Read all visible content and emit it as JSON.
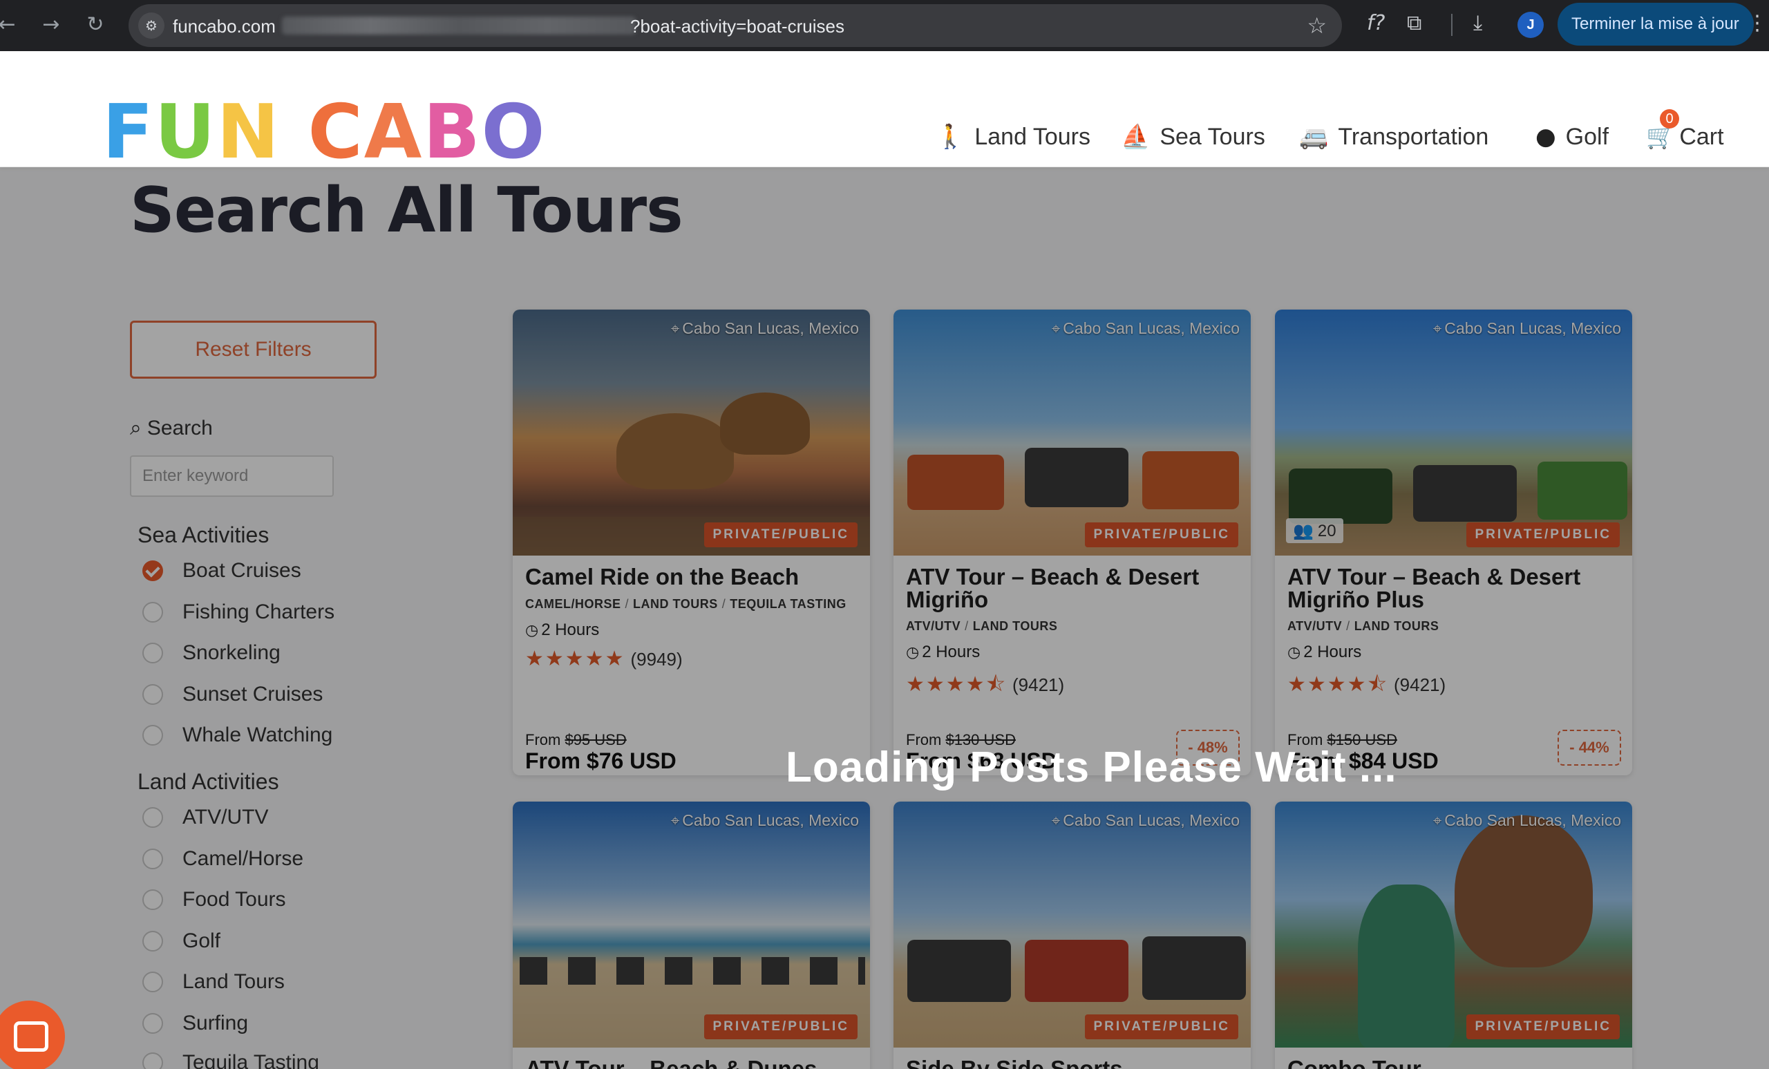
{
  "browser": {
    "url_host": "funcabo.com",
    "url_query": "?boat-activity=boat-cruises",
    "update_label": "Terminer la mise à jour",
    "profile_initial": "J",
    "icons": [
      "back-icon",
      "forward-icon",
      "reload-icon",
      "site-settings-icon",
      "bookmark-star-icon",
      "formula-icon",
      "extensions-icon",
      "download-icon",
      "menu-kebab-icon"
    ]
  },
  "site": {
    "logo_letters": [
      {
        "ch": "F",
        "color": "#3aa0e6"
      },
      {
        "ch": "U",
        "color": "#7ac943"
      },
      {
        "ch": "N",
        "color": "#f5c445"
      },
      {
        "ch": " ",
        "color": "#ffffff"
      },
      {
        "ch": "C",
        "color": "#ee6f3c"
      },
      {
        "ch": "A",
        "color": "#ef7a4a"
      },
      {
        "ch": "B",
        "color": "#e25da2"
      },
      {
        "ch": "O",
        "color": "#7b6fd0"
      }
    ],
    "nav": {
      "land_tours": "Land Tours",
      "sea_tours": "Sea Tours",
      "transportation": "Transportation",
      "golf": "Golf",
      "cart": "Cart",
      "cart_count": "0"
    },
    "accent_color": "#ea5a2b"
  },
  "page": {
    "title": "Search All Tours",
    "loading_text": "Loading Posts Please Wait ..."
  },
  "filters": {
    "reset_label": "Reset Filters",
    "search_label": "Search",
    "search_placeholder": "Enter keyword",
    "sea_heading": "Sea Activities",
    "sea": [
      "Boat Cruises",
      "Fishing Charters",
      "Snorkeling",
      "Sunset Cruises",
      "Whale Watching"
    ],
    "sea_checked": "Boat Cruises",
    "land_heading": "Land Activities",
    "land": [
      "ATV/UTV",
      "Camel/Horse",
      "Food Tours",
      "Golf",
      "Land Tours",
      "Surfing",
      "Tequila Tasting"
    ]
  },
  "cards": [
    {
      "location": "Cabo San Lucas, Mexico",
      "tag": "PRIVATE/PUBLIC",
      "title": "Camel Ride on the Beach",
      "cats": [
        "CAMEL/HORSE",
        "LAND TOURS",
        "TEQUILA TASTING"
      ],
      "duration": "2 Hours",
      "stars": "★★★★★",
      "reviews": "(9949)",
      "from_prefix": "From",
      "old_price": "$95 USD",
      "new_price": "From $76 USD"
    },
    {
      "location": "Cabo San Lucas, Mexico",
      "tag": "PRIVATE/PUBLIC",
      "title": "ATV Tour – Beach & Desert Migriño",
      "cats": [
        "ATV/UTV",
        "LAND TOURS"
      ],
      "duration": "2 Hours",
      "stars": "★★★★⯪",
      "reviews": "(9421)",
      "from_prefix": "From",
      "old_price": "$130 USD",
      "new_price": "From $68 USD",
      "discount": "- 48%"
    },
    {
      "location": "Cabo San Lucas, Mexico",
      "tag": "PRIVATE/PUBLIC",
      "guests": "20",
      "title": "ATV Tour – Beach & Desert Migriño Plus",
      "cats": [
        "ATV/UTV",
        "LAND TOURS"
      ],
      "duration": "2 Hours",
      "stars": "★★★★⯪",
      "reviews": "(9421)",
      "from_prefix": "From",
      "old_price": "$150 USD",
      "new_price": "From $84 USD",
      "discount": "- 44%"
    },
    {
      "location": "Cabo San Lucas, Mexico",
      "tag": "PRIVATE/PUBLIC",
      "title": "ATV Tour – Beach & Dunes"
    },
    {
      "location": "Cabo San Lucas, Mexico",
      "tag": "PRIVATE/PUBLIC",
      "title": "Side By Side Sports Adventure"
    },
    {
      "location": "Cabo San Lucas, Mexico",
      "tag": "PRIVATE/PUBLIC",
      "title": "Combo Tour"
    }
  ]
}
